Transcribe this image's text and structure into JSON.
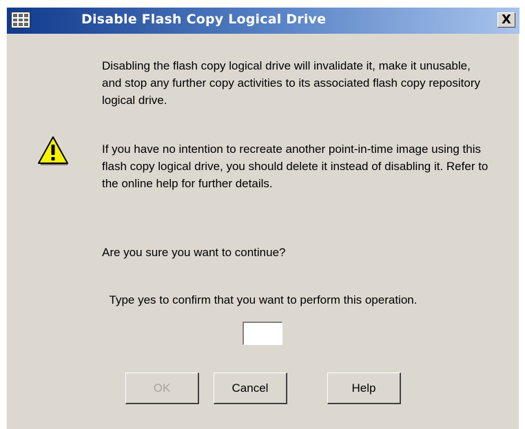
{
  "window": {
    "title": "Disable Flash Copy Logical Drive",
    "app_icon": "grid-app-icon",
    "close_label": "X",
    "close_icon": "close-icon"
  },
  "message": {
    "warning_icon": "warning-icon",
    "paragraph1": "Disabling the flash copy logical drive will invalidate it, make it unusable, and stop any further copy activities to its associated flash copy repository logical drive.",
    "paragraph2": "If you have no intention to recreate another point-in-time image using this flash copy logical drive, you should delete it instead of disabling it. Refer to the online help for further details.",
    "question": "Are you sure you want to continue?"
  },
  "confirm": {
    "label": "Type yes to confirm that you want to perform this operation.",
    "value": ""
  },
  "buttons": {
    "ok": "OK",
    "cancel": "Cancel",
    "help": "Help"
  },
  "colors": {
    "title_gradient_start": "#103a8c",
    "title_gradient_end": "#a9c4ec",
    "dialog_background": "#dcd8d0",
    "warning_yellow": "#f7f300"
  }
}
